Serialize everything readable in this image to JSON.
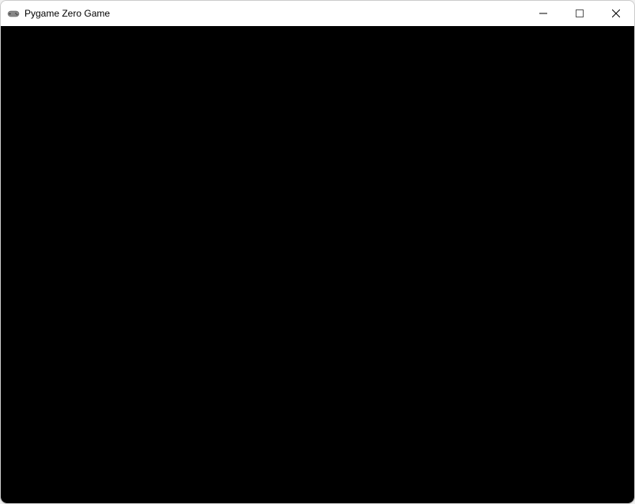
{
  "window": {
    "title": "Pygame Zero Game",
    "icon": "gamepad-icon",
    "controls": {
      "minimize": "minimize",
      "maximize": "maximize",
      "close": "close"
    }
  },
  "game": {
    "background_color": "#000000"
  }
}
